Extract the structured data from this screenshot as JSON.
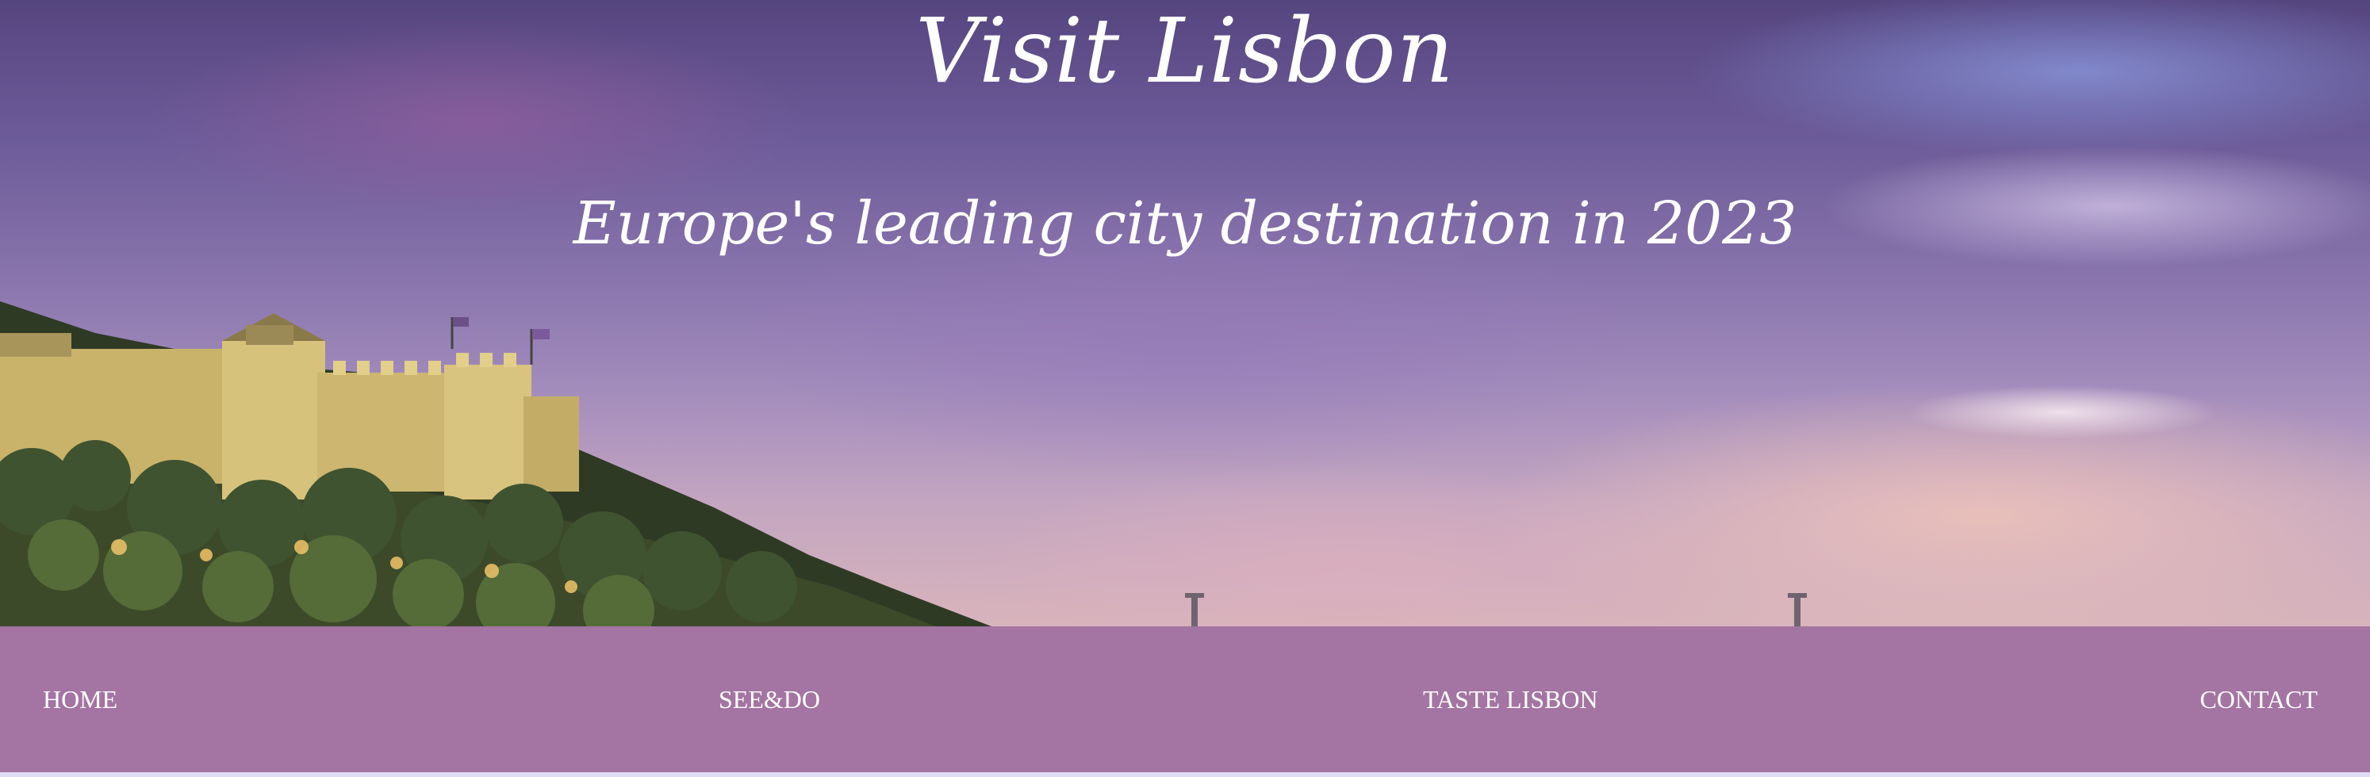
{
  "hero": {
    "title": "Visit Lisbon",
    "subtitle": "Europe's leading city destination in 2023",
    "image": "lisbon-castle-at-dusk"
  },
  "nav": {
    "items": [
      {
        "label": "HOME"
      },
      {
        "label": "SEE&DO"
      },
      {
        "label": "TASTE LISBON"
      },
      {
        "label": "CONTACT"
      }
    ]
  },
  "colors": {
    "navbar_bg": "#a474a3",
    "nav_text": "#ffffff",
    "title_text": "#ffffff",
    "page_bg": "#dcdcf6"
  }
}
